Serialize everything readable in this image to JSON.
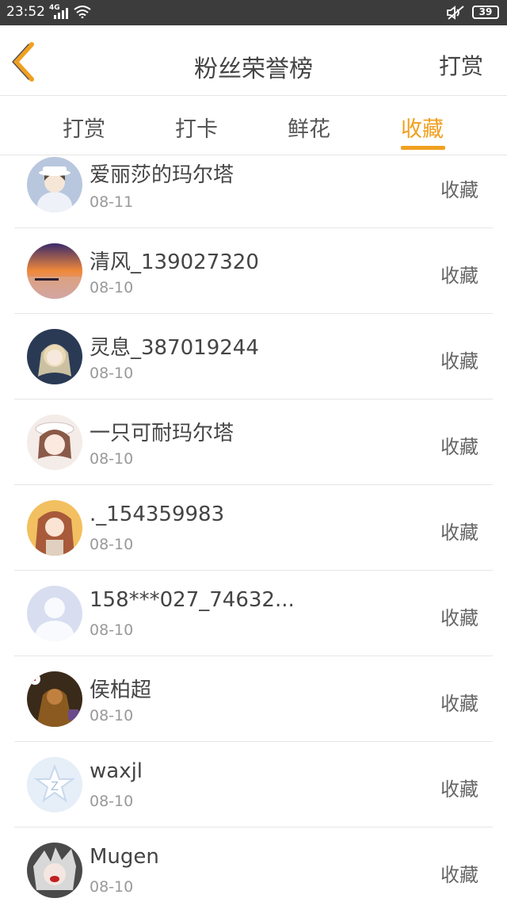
{
  "statusbar": {
    "time": "23:52",
    "network": "4G",
    "battery": "39"
  },
  "header": {
    "title": "粉丝荣誉榜",
    "action": "打赏"
  },
  "tabs": [
    {
      "label": "打赏",
      "active": false
    },
    {
      "label": "打卡",
      "active": false
    },
    {
      "label": "鲜花",
      "active": false
    },
    {
      "label": "收藏",
      "active": true
    }
  ],
  "colors": {
    "accent": "#f0a020",
    "statusbar": "#3c3c3c"
  },
  "rows": [
    {
      "name": "爱丽莎的玛尔塔",
      "date": "08-11",
      "action": "收藏"
    },
    {
      "name": "清风_139027320",
      "date": "08-10",
      "action": "收藏"
    },
    {
      "name": "灵息_387019244",
      "date": "08-10",
      "action": "收藏"
    },
    {
      "name": "一只可耐玛尔塔",
      "date": "08-10",
      "action": "收藏"
    },
    {
      "name": "._154359983",
      "date": "08-10",
      "action": "收藏"
    },
    {
      "name": "158***027_74632...",
      "date": "08-10",
      "action": "收藏"
    },
    {
      "name": "侯柏超",
      "date": "08-10",
      "action": "收藏"
    },
    {
      "name": "waxjl",
      "date": "08-10",
      "action": "收藏"
    },
    {
      "name": "Mugen",
      "date": "08-10",
      "action": "收藏"
    }
  ]
}
